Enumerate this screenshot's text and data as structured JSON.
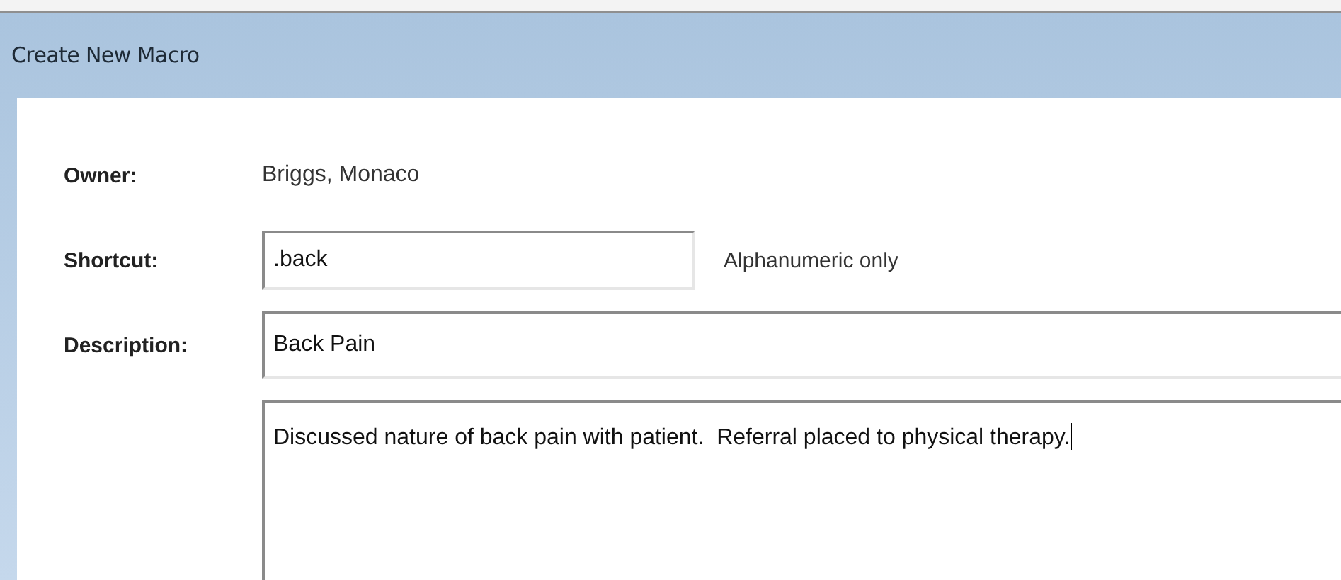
{
  "window": {
    "title": "Create New Macro"
  },
  "fields": [
    {
      "kind": "static",
      "label": "Owner:",
      "value": "Briggs, Monaco"
    },
    {
      "kind": "input",
      "label": "Shortcut:",
      "value": ".back",
      "hint": "Alphanumeric only"
    },
    {
      "kind": "input",
      "label": "Description:",
      "value": "Back Pain"
    },
    {
      "kind": "textarea",
      "value": "Discussed nature of back pain with patient.  Referral placed to physical therapy.",
      "focused": true
    }
  ]
}
